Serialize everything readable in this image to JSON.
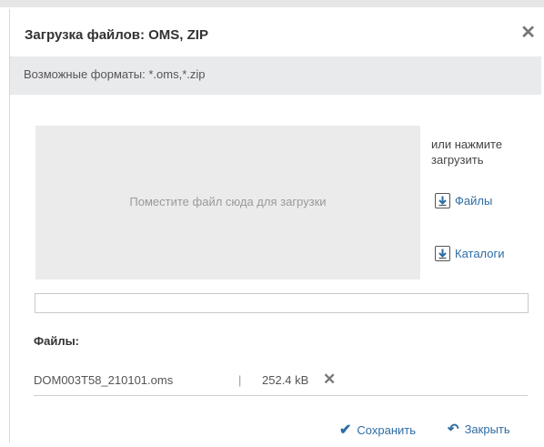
{
  "dialog": {
    "title": "Загрузка файлов: OMS, ZIP",
    "close_icon": "close-icon",
    "formats_text": "Возможные форматы: *.oms,*.zip"
  },
  "dropzone": {
    "hint": "Поместите файл сюда для загрузки"
  },
  "side": {
    "text": "или нажмите загрузить",
    "files_label": "Файлы",
    "dirs_label": "Каталоги",
    "icon": "download-icon"
  },
  "upload": {
    "progress": 0
  },
  "files": {
    "label": "Файлы:",
    "items": [
      {
        "name": "DOM003T58_210101.oms",
        "separator": "|",
        "size": "252.4 kB",
        "remove_icon": "remove-icon"
      }
    ]
  },
  "footer": {
    "save_label": "Сохранить",
    "close_label": "Закрыть",
    "save_icon": "check-icon",
    "close_icon": "undo-icon"
  },
  "colors": {
    "accent": "#2e6da4",
    "formats_bg": "#e9eaec",
    "dropzone_bg": "#ebebeb"
  }
}
